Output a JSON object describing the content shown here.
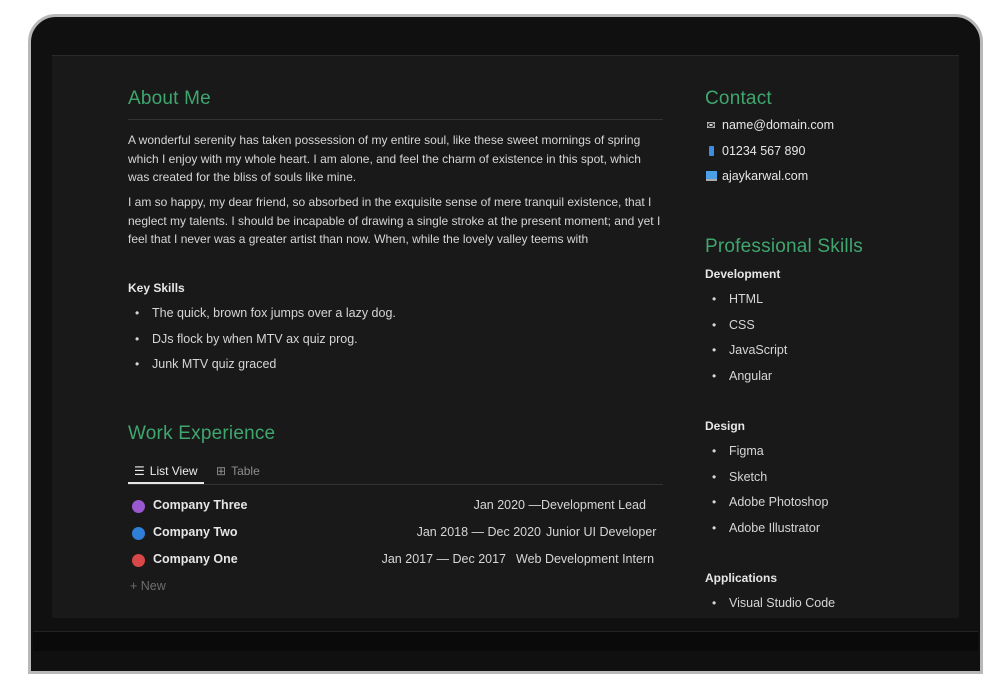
{
  "about": {
    "heading": "About Me",
    "paragraphs": [
      "A wonderful serenity has taken possession of my entire soul, like these sweet mornings of spring which I enjoy with my whole heart. I am alone, and feel the charm of existence in this spot, which was created for the bliss of souls like mine.",
      "I am so happy, my dear friend, so absorbed in the exquisite sense of mere tranquil existence, that I neglect my talents. I should be incapable of drawing a single stroke at the present moment; and yet I feel that I never was a greater artist than now. When, while the lovely valley teems with"
    ]
  },
  "key_skills": {
    "heading": "Key Skills",
    "items": [
      "The quick, brown fox jumps over a lazy dog.",
      "DJs flock by when MTV ax quiz prog.",
      "Junk MTV quiz graced"
    ]
  },
  "work": {
    "heading": "Work Experience",
    "tabs": [
      {
        "label": "List View",
        "icon": "list-icon"
      },
      {
        "label": "Table",
        "icon": "table-icon"
      }
    ],
    "rows": [
      {
        "company": "Company Three",
        "dates": "Jan 2020 —",
        "role": "Development Lead",
        "color": "#9b59d0"
      },
      {
        "company": "Company Two",
        "dates": "Jan 2018 — Dec 2020",
        "role": "Junior UI Developer",
        "color": "#2f7fd8"
      },
      {
        "company": "Company One",
        "dates": "Jan 2017 — Dec 2017",
        "role": "Web Development Intern",
        "color": "#d94848"
      }
    ],
    "new_label": "+ New"
  },
  "contact": {
    "heading": "Contact",
    "items": [
      {
        "icon": "envelope-icon",
        "text": "name@domain.com"
      },
      {
        "icon": "phone-icon",
        "text": "01234 567 890"
      },
      {
        "icon": "laptop-icon",
        "text": "ajaykarwal.com"
      }
    ]
  },
  "skills": {
    "heading": "Professional Skills",
    "groups": [
      {
        "title": "Development",
        "items": [
          "HTML",
          "CSS",
          "JavaScript",
          "Angular"
        ]
      },
      {
        "title": "Design",
        "items": [
          "Figma",
          "Sketch",
          "Adobe Photoshop",
          "Adobe Illustrator"
        ]
      },
      {
        "title": "Applications",
        "items": [
          "Visual Studio Code"
        ]
      }
    ]
  }
}
